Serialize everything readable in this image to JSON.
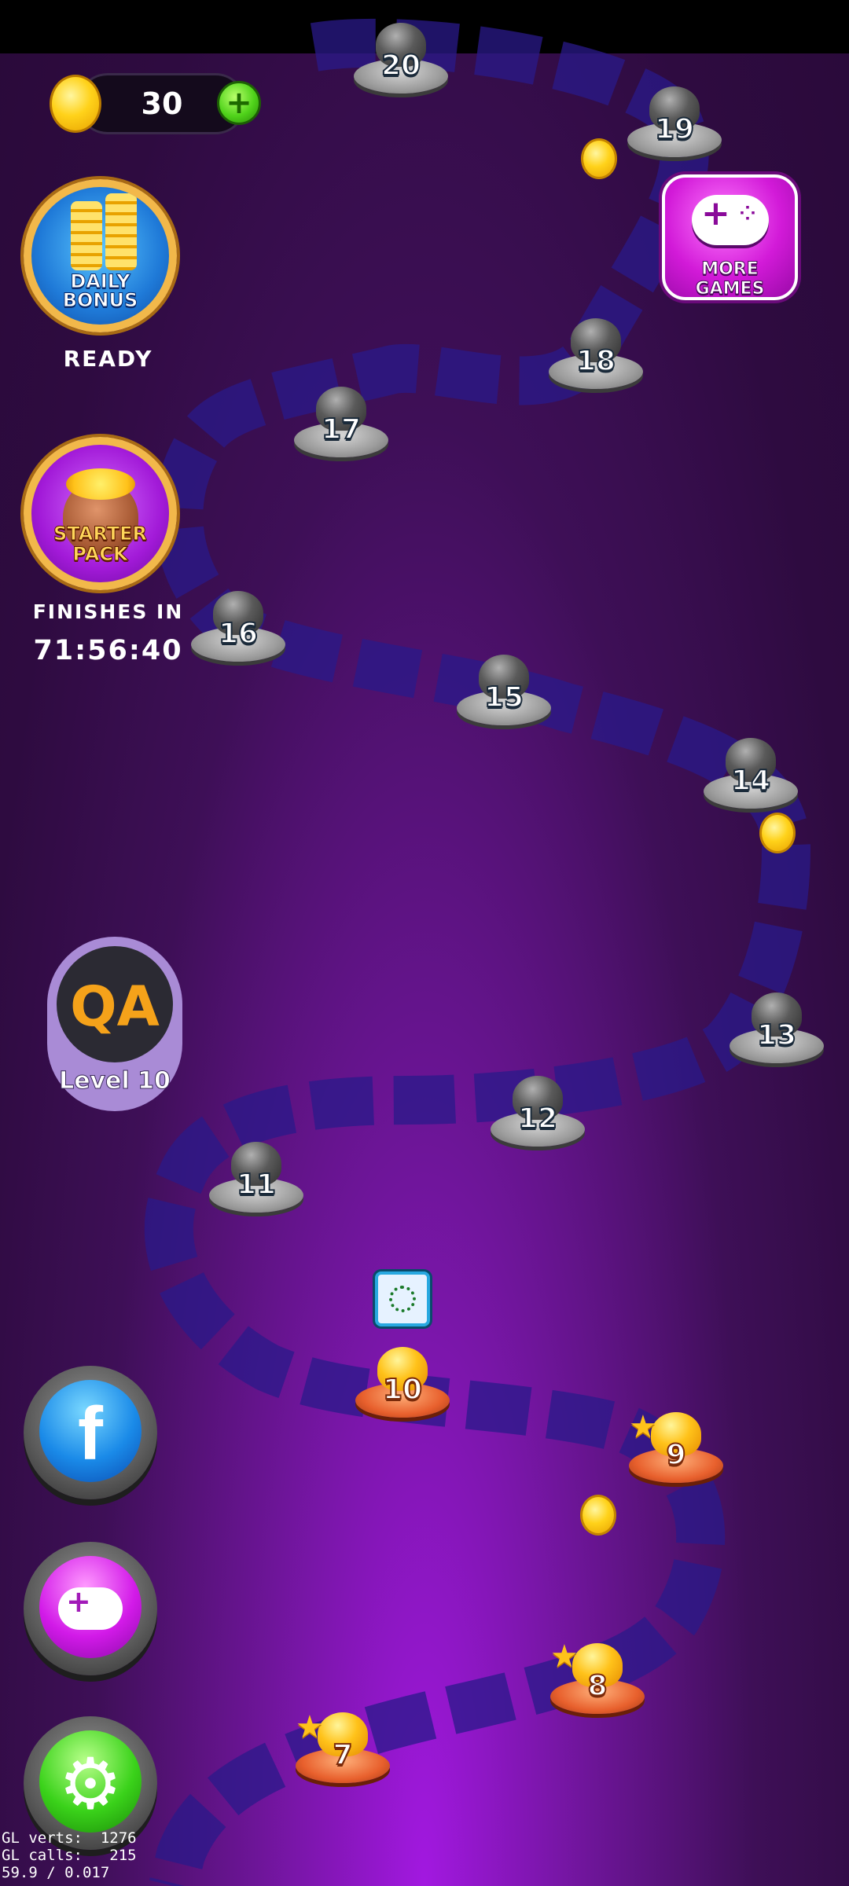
{
  "coins": {
    "value": "30"
  },
  "daily_bonus": {
    "label": "DAILY BONUS",
    "status": "READY"
  },
  "starter_pack": {
    "label": "STARTER PACK",
    "caption": "FINISHES IN",
    "timer": "71:56:40"
  },
  "more_games": {
    "label": "MORE GAMES"
  },
  "profile": {
    "initials": "QA",
    "level_label": "Level 10"
  },
  "facebook": {
    "glyph": "f"
  },
  "settings": {
    "glyph": "⚙"
  },
  "levels": [
    {
      "number": "7",
      "state": "completed"
    },
    {
      "number": "8",
      "state": "completed"
    },
    {
      "number": "9",
      "state": "completed"
    },
    {
      "number": "10",
      "state": "current"
    },
    {
      "number": "11",
      "state": "locked"
    },
    {
      "number": "12",
      "state": "locked"
    },
    {
      "number": "13",
      "state": "locked"
    },
    {
      "number": "14",
      "state": "locked"
    },
    {
      "number": "15",
      "state": "locked"
    },
    {
      "number": "16",
      "state": "locked"
    },
    {
      "number": "17",
      "state": "locked"
    },
    {
      "number": "18",
      "state": "locked"
    },
    {
      "number": "19",
      "state": "locked"
    },
    {
      "number": "20",
      "state": "locked"
    }
  ],
  "debug": {
    "line1": "GL verts:  1276",
    "line2": "GL calls:   215",
    "line3": "59.9 / 0.017"
  },
  "icons": {
    "coin": "coin-icon",
    "add": "plus-icon",
    "facebook": "facebook-icon",
    "gamepad": "gamepad-icon",
    "settings": "gear-icon",
    "gift": "gift-box-icon",
    "star": "star-icon"
  },
  "colors": {
    "background": "#3e0f57",
    "path": "#2a1a8a",
    "accent_gold": "#ffc21a",
    "accent_magenta": "#d21ad8"
  }
}
